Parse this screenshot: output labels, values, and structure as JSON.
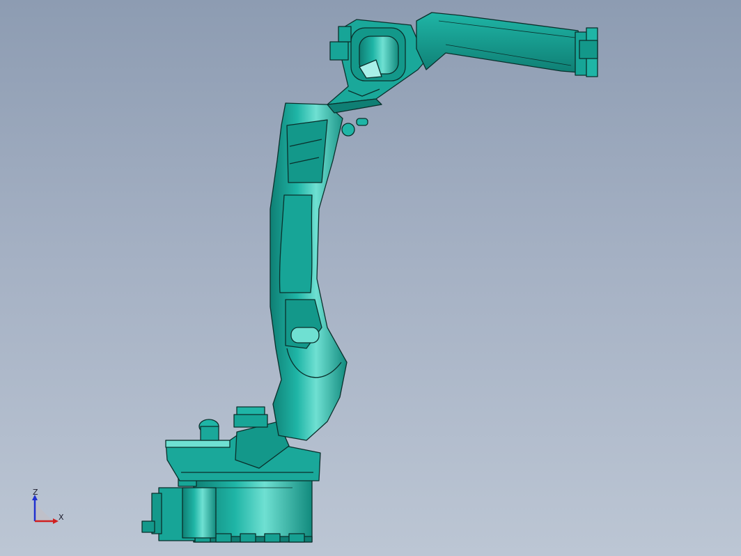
{
  "viewport": {
    "background_top": "#8d9cb2",
    "background_bottom": "#bcc6d4"
  },
  "model": {
    "body_color": "#1aa89a",
    "shade_color": "#0f7f74",
    "highlight_color": "#6fe0d2",
    "edge_color": "#0a2f2b"
  },
  "triad": {
    "z_label": "Z",
    "x_label": "X",
    "z_color": "#2030d0",
    "x_color": "#d02020"
  }
}
